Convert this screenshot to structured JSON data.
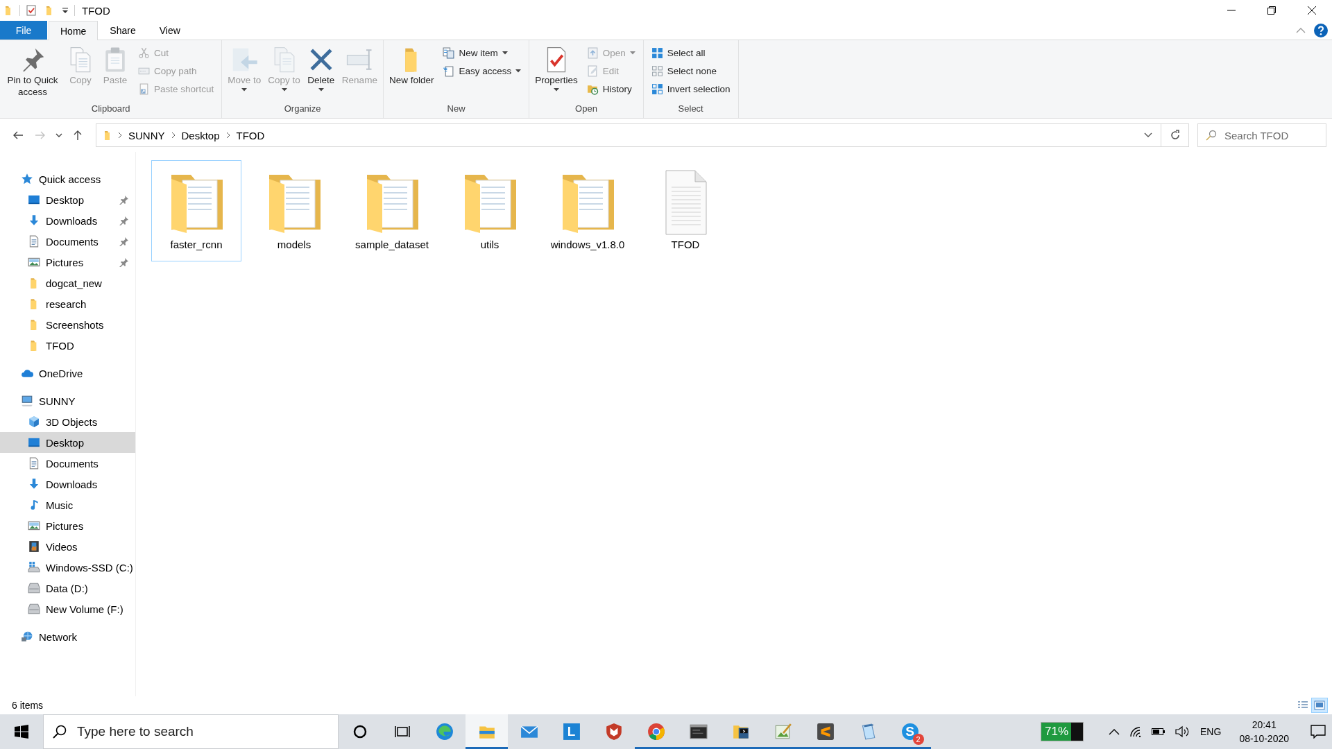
{
  "window": {
    "title": "TFOD"
  },
  "ribbon_tabs": [
    {
      "label": "File",
      "kind": "menu",
      "selected": false
    },
    {
      "label": "Home",
      "kind": "tab",
      "selected": true
    },
    {
      "label": "Share",
      "kind": "tab",
      "selected": false
    },
    {
      "label": "View",
      "kind": "tab",
      "selected": false
    }
  ],
  "ribbon_groups": [
    {
      "label": "Clipboard",
      "items": [
        {
          "kind": "large",
          "label": "Pin to Quick access",
          "disabled": false,
          "menu": false
        },
        {
          "kind": "large",
          "label": "Copy",
          "disabled": true,
          "menu": false
        },
        {
          "kind": "large",
          "label": "Paste",
          "disabled": true,
          "menu": false
        },
        {
          "kind": "stack",
          "items": [
            {
              "label": "Cut",
              "disabled": true,
              "menu": false
            },
            {
              "label": "Copy path",
              "disabled": true,
              "menu": false
            },
            {
              "label": "Paste shortcut",
              "disabled": true,
              "menu": false
            }
          ]
        }
      ]
    },
    {
      "label": "Organize",
      "items": [
        {
          "kind": "large",
          "label": "Move to",
          "disabled": true,
          "menu": true
        },
        {
          "kind": "large",
          "label": "Copy to",
          "disabled": true,
          "menu": true
        },
        {
          "kind": "large",
          "label": "Delete",
          "disabled": false,
          "menu": true
        },
        {
          "kind": "large",
          "label": "Rename",
          "disabled": true,
          "menu": false
        }
      ]
    },
    {
      "label": "New",
      "items": [
        {
          "kind": "large",
          "label": "New folder",
          "disabled": false,
          "menu": false
        },
        {
          "kind": "stack",
          "items": [
            {
              "label": "New item",
              "disabled": false,
              "menu": true
            },
            {
              "label": "Easy access",
              "disabled": false,
              "menu": true
            }
          ]
        }
      ]
    },
    {
      "label": "Open",
      "items": [
        {
          "kind": "large",
          "label": "Properties",
          "disabled": false,
          "menu": true
        },
        {
          "kind": "stack",
          "items": [
            {
              "label": "Open",
              "disabled": true,
              "menu": true
            },
            {
              "label": "Edit",
              "disabled": true,
              "menu": false
            },
            {
              "label": "History",
              "disabled": false,
              "menu": false
            }
          ]
        }
      ]
    },
    {
      "label": "Select",
      "items": [
        {
          "kind": "stack",
          "items": [
            {
              "label": "Select all",
              "disabled": false,
              "menu": false
            },
            {
              "label": "Select none",
              "disabled": false,
              "menu": false
            },
            {
              "label": "Invert selection",
              "disabled": false,
              "menu": false
            }
          ]
        }
      ]
    }
  ],
  "address_bar": {
    "back_disabled": false,
    "forward_disabled": true,
    "breadcrumbs": [
      "SUNNY",
      "Desktop",
      "TFOD"
    ]
  },
  "search": {
    "placeholder": "Search TFOD"
  },
  "navigation": [
    {
      "label": "Quick access",
      "kind": "star",
      "selected": false,
      "children": [
        {
          "label": "Desktop",
          "kind": "desktop",
          "pinned": true,
          "selected": false
        },
        {
          "label": "Downloads",
          "kind": "downloads",
          "pinned": true,
          "selected": false
        },
        {
          "label": "Documents",
          "kind": "documents",
          "pinned": true,
          "selected": false
        },
        {
          "label": "Pictures",
          "kind": "pictures",
          "pinned": true,
          "selected": false
        },
        {
          "label": "dogcat_new",
          "kind": "folder",
          "pinned": false,
          "selected": false
        },
        {
          "label": "research",
          "kind": "folder",
          "pinned": false,
          "selected": false
        },
        {
          "label": "Screenshots",
          "kind": "folder",
          "pinned": false,
          "selected": false
        },
        {
          "label": "TFOD",
          "kind": "folder",
          "pinned": false,
          "selected": false
        }
      ]
    },
    {
      "label": "OneDrive",
      "kind": "cloud",
      "selected": false
    },
    {
      "label": "SUNNY",
      "kind": "computer",
      "selected": false,
      "children": [
        {
          "label": "3D Objects",
          "kind": "cube",
          "pinned": false,
          "selected": false
        },
        {
          "label": "Desktop",
          "kind": "desktop",
          "pinned": false,
          "selected": true
        },
        {
          "label": "Documents",
          "kind": "documents",
          "pinned": false,
          "selected": false
        },
        {
          "label": "Downloads",
          "kind": "downloads",
          "pinned": false,
          "selected": false
        },
        {
          "label": "Music",
          "kind": "music",
          "pinned": false,
          "selected": false
        },
        {
          "label": "Pictures",
          "kind": "pictures",
          "pinned": false,
          "selected": false
        },
        {
          "label": "Videos",
          "kind": "videos",
          "pinned": false,
          "selected": false
        },
        {
          "label": "Windows-SSD (C:)",
          "kind": "system-drive",
          "pinned": false,
          "selected": false
        },
        {
          "label": "Data (D:)",
          "kind": "drive",
          "pinned": false,
          "selected": false
        },
        {
          "label": "New Volume (F:)",
          "kind": "drive",
          "pinned": false,
          "selected": false
        }
      ]
    },
    {
      "label": "Network",
      "kind": "network",
      "selected": false
    }
  ],
  "files": [
    {
      "name": "faster_rcnn",
      "kind": "folder",
      "selected": true
    },
    {
      "name": "models",
      "kind": "folder",
      "selected": false
    },
    {
      "name": "sample_dataset",
      "kind": "folder",
      "selected": false
    },
    {
      "name": "utils",
      "kind": "folder",
      "selected": false
    },
    {
      "name": "windows_v1.8.0",
      "kind": "folder",
      "selected": false
    },
    {
      "name": "TFOD",
      "kind": "file",
      "selected": false
    }
  ],
  "status_bar": {
    "item_count": "6 items",
    "views": [
      {
        "selected": false
      },
      {
        "selected": true
      }
    ]
  },
  "taskbar": {
    "search": {
      "placeholder": "Type here to search"
    },
    "apps": [
      {
        "running": false,
        "active": false
      },
      {
        "running": true,
        "active": true
      },
      {
        "running": false,
        "active": false
      },
      {
        "running": false,
        "active": false,
        "glyph": "L"
      },
      {
        "running": false,
        "active": false
      },
      {
        "running": true,
        "active": false
      },
      {
        "running": true,
        "active": false
      },
      {
        "running": true,
        "active": false
      },
      {
        "running": true,
        "active": false
      },
      {
        "running": true,
        "active": false
      },
      {
        "running": true,
        "active": false
      },
      {
        "running": true,
        "active": false,
        "glyph": "S",
        "badge": "2"
      }
    ],
    "battery": {
      "reading": "71%",
      "level": 0.71
    },
    "language": "ENG",
    "time": "20:41",
    "date": "08-10-2020"
  }
}
